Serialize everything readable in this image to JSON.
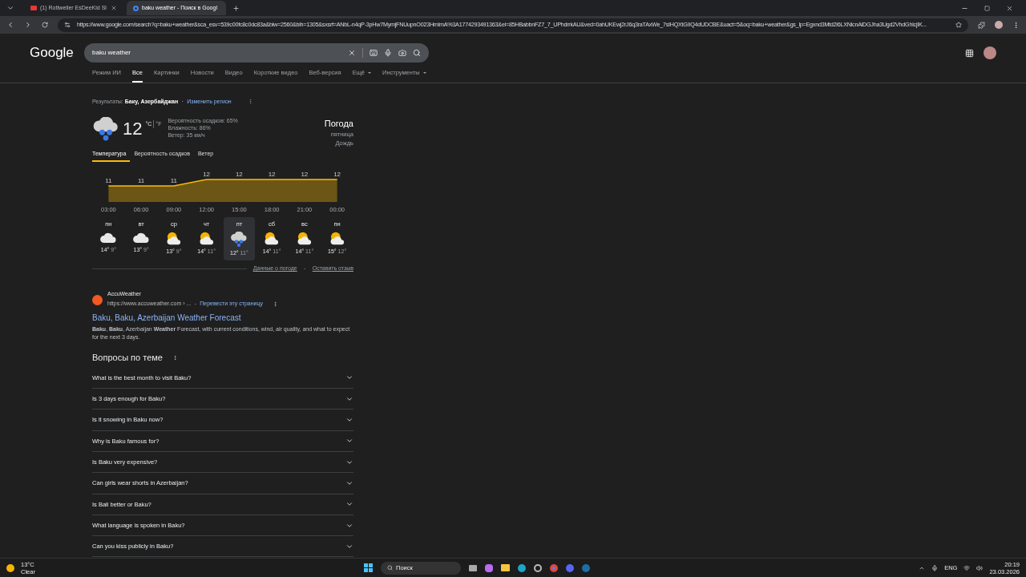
{
  "browser": {
    "tabs": [
      {
        "title": "(1) Rottweiler EsDeeKid Sl",
        "selected": false,
        "kind": "video"
      },
      {
        "title": "baku weather - Поиск в Googl",
        "selected": true,
        "kind": "google"
      }
    ],
    "url": "https://www.google.com/search?q=baku+weather&sca_esv=539c00fc8c0dc83a&biw=2560&bih=1305&sxsrf=ANbL-n4qP-3pHw7MymjFNUupnO023HmlmA%3A1774293491363&ei=85HBabbnFZ7_7_UPhdrrkAU&ved=0ahUKEwj2rJ6q3raTAxWe_7sIHQXtGIIQ4dUDCBE&uact=5&oq=baku+weather&gs_lp=Egxnd3Mtd2l6LXNlcnAiDGJha3Ugd2VhdGhlcjIK..."
  },
  "search": {
    "logo": "Google",
    "query": "baku weather"
  },
  "nav": [
    {
      "label": "Режим ИИ",
      "selected": false,
      "dropdown": false
    },
    {
      "label": "Все",
      "selected": true,
      "dropdown": false
    },
    {
      "label": "Картинки",
      "selected": false,
      "dropdown": false
    },
    {
      "label": "Новости",
      "selected": false,
      "dropdown": false
    },
    {
      "label": "Видео",
      "selected": false,
      "dropdown": false
    },
    {
      "label": "Короткие видео",
      "selected": false,
      "dropdown": false
    },
    {
      "label": "Веб-версия",
      "selected": false,
      "dropdown": false
    },
    {
      "label": "Ещё",
      "selected": false,
      "dropdown": true
    },
    {
      "label": "Инструменты",
      "selected": false,
      "dropdown": true
    }
  ],
  "region": {
    "prefix": "Результаты:",
    "place": "Баку, Азербайджан",
    "separator": "·",
    "change": "Изменить регион"
  },
  "weather": {
    "temp": "12",
    "unit_c": "°C",
    "unit_f": "°F",
    "details": [
      "Вероятность осадков: 65%",
      "Влажность: 86%",
      "Ветер: 35 км/ч"
    ],
    "title": "Погода",
    "day": "пятница",
    "condition": "Дождь",
    "tabs": [
      {
        "label": "Температура",
        "selected": true
      },
      {
        "label": "Вероятность осадков",
        "selected": false
      },
      {
        "label": "Ветер",
        "selected": false
      }
    ],
    "chart_data": {
      "type": "area",
      "categories": [
        "03:00",
        "06:00",
        "09:00",
        "12:00",
        "15:00",
        "18:00",
        "21:00",
        "00:00"
      ],
      "series": [
        {
          "color": "#fbbc04",
          "values": [
            11,
            11,
            11,
            12,
            12,
            12,
            12,
            12
          ]
        }
      ],
      "data_labels": true
    },
    "days": [
      {
        "day": "пн",
        "kind": "cloudy",
        "high": "14°",
        "low": "9°",
        "selected": false
      },
      {
        "day": "вт",
        "kind": "cloudy",
        "high": "13°",
        "low": "9°",
        "selected": false
      },
      {
        "day": "ср",
        "kind": "partly",
        "high": "13°",
        "low": "9°",
        "selected": false
      },
      {
        "day": "чт",
        "kind": "partly",
        "high": "14°",
        "low": "11°",
        "selected": false
      },
      {
        "day": "пт",
        "kind": "rain",
        "high": "12°",
        "low": "11°",
        "selected": true
      },
      {
        "day": "сб",
        "kind": "partly",
        "high": "14°",
        "low": "11°",
        "selected": false
      },
      {
        "day": "вс",
        "kind": "partly",
        "high": "14°",
        "low": "11°",
        "selected": false
      },
      {
        "day": "пн",
        "kind": "partly",
        "high": "15°",
        "low": "12°",
        "selected": false
      }
    ],
    "links": [
      "Данные о погоде",
      "·",
      "Оставить отзыв"
    ]
  },
  "result": {
    "site": "AccuWeather",
    "url": "https://www.accuweather.com › ...",
    "separator": "·",
    "translate": "Перевести эту страницу",
    "title": "Baku, Baku, Azerbaijan Weather Forecast",
    "snippet": "**Baku**, **Baku**, Azerbaijan **Weather** Forecast, with current conditions, wind, air quality, and what to expect for the next 3 days."
  },
  "questions": {
    "title": "Вопросы по теме",
    "items": [
      {
        "text": "What is the best month to visit Baku?",
        "expanded": false
      },
      {
        "text": "Is 3 days enough for Baku?",
        "expanded": false
      },
      {
        "text": "Is it snowing in Baku now?",
        "expanded": false
      },
      {
        "text": "Why is Baku famous for?",
        "expanded": false
      },
      {
        "text": "Is Baku very expensive?",
        "expanded": false
      },
      {
        "text": "Can girls wear shorts in Azerbaijan?",
        "expanded": false
      },
      {
        "text": "Is Bali better or Baku?",
        "expanded": false
      },
      {
        "text": "What language is spoken in Baku?",
        "expanded": false
      },
      {
        "text": "Can you kiss publicly in Baku?",
        "expanded": false
      }
    ]
  },
  "taskbar": {
    "weather_temp": "13°C",
    "weather_text": "Clear",
    "search": "Поиск",
    "lang": "ENG",
    "time": "20:19",
    "date": "23.03.2026"
  }
}
